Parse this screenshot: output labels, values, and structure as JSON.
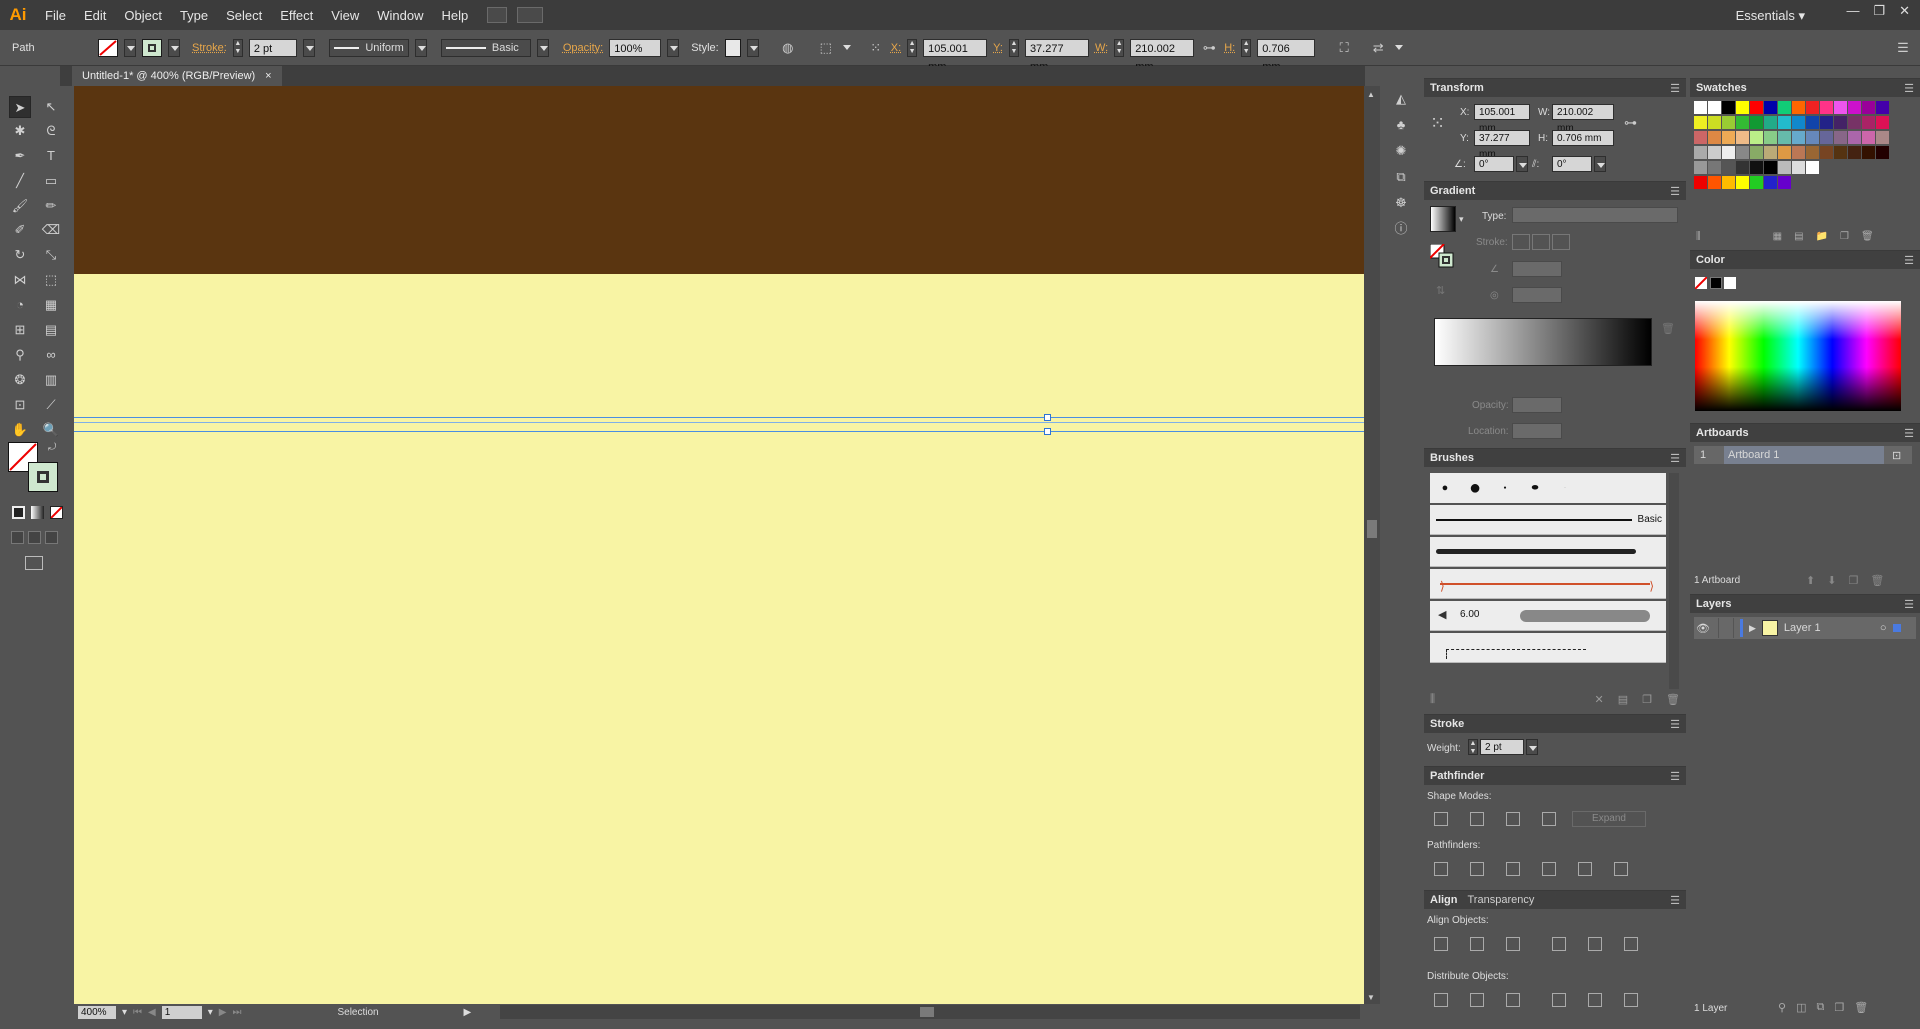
{
  "app": {
    "logo": "Ai",
    "workspace": "Essentials",
    "win_min": "—",
    "win_max": "❐",
    "win_close": "✕"
  },
  "menu": [
    "File",
    "Edit",
    "Object",
    "Type",
    "Select",
    "Effect",
    "View",
    "Window",
    "Help"
  ],
  "control_bar": {
    "selection_type": "Path",
    "stroke_label": "Stroke:",
    "stroke_weight": "2 pt",
    "stroke_profile": "Uniform",
    "brush": "Basic",
    "opacity_label": "Opacity:",
    "opacity_value": "100%",
    "style_label": "Style:",
    "x_label": "X:",
    "x_value": "105.001 mm",
    "y_label": "Y:",
    "y_value": "37.277 mm",
    "w_label": "W:",
    "w_value": "210.002 mm",
    "h_label": "H:",
    "h_value": "0.706 mm"
  },
  "document": {
    "tab_title": "Untitled-1* @ 400% (RGB/Preview)",
    "close": "×"
  },
  "status_bar": {
    "zoom": "400%",
    "artboard_num": "1",
    "tool_name": "Selection"
  },
  "transform": {
    "title": "Transform",
    "x_label": "X:",
    "x": "105.001 mm",
    "y_label": "Y:",
    "y": "37.277 mm",
    "w_label": "W:",
    "w": "210.002 mm",
    "h_label": "H:",
    "h": "0.706 mm",
    "angle": "0°",
    "shear": "0°"
  },
  "gradient": {
    "title": "Gradient",
    "type_label": "Type:",
    "stroke_label": "Stroke:",
    "opacity_label": "Opacity:",
    "location_label": "Location:"
  },
  "brushes": {
    "title": "Brushes",
    "basic_label": "Basic",
    "size_value": "6.00"
  },
  "stroke_panel": {
    "title": "Stroke",
    "weight_label": "Weight:",
    "weight": "2 pt"
  },
  "pathfinder": {
    "title": "Pathfinder",
    "shape_modes": "Shape Modes:",
    "expand": "Expand",
    "pathfinders": "Pathfinders:"
  },
  "align": {
    "title": "Align",
    "tab2": "Transparency",
    "align_objects": "Align Objects:",
    "distribute_objects": "Distribute Objects:"
  },
  "swatches": {
    "title": "Swatches"
  },
  "color": {
    "title": "Color"
  },
  "artboards": {
    "title": "Artboards",
    "rows": [
      {
        "num": "1",
        "name": "Artboard 1"
      }
    ],
    "count": "1 Artboard"
  },
  "layers": {
    "title": "Layers",
    "rows": [
      {
        "name": "Layer 1"
      }
    ],
    "count": "1 Layer"
  },
  "colors": {
    "brown": "#5a3510",
    "cream": "#f8f4a4",
    "selection": "#4b8ee2",
    "accent": "#ff9a00"
  }
}
